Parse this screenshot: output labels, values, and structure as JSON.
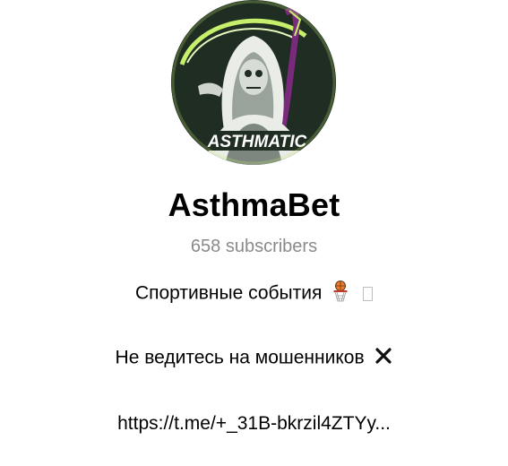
{
  "channel": {
    "avatar_text": "ASTHMATIC",
    "name": "AsthmaBet",
    "subscribers": "658 subscribers"
  },
  "description": {
    "line1": "Спортивные события",
    "line1_icon": "basketball-hoop-icon",
    "line1_trailing_icon": "missing-glyph-icon",
    "line2": "Не ведитесь на мошенников",
    "line2_icon": "cross-mark-icon",
    "link": "https://t.me/+_31B-bkrzil4ZTYy..."
  },
  "colors": {
    "avatar_background": "#1f2d22",
    "avatar_accent": "#c6ef6b",
    "avatar_staff": "#7a2a7c",
    "subscribers_text": "#8a8a8a"
  }
}
